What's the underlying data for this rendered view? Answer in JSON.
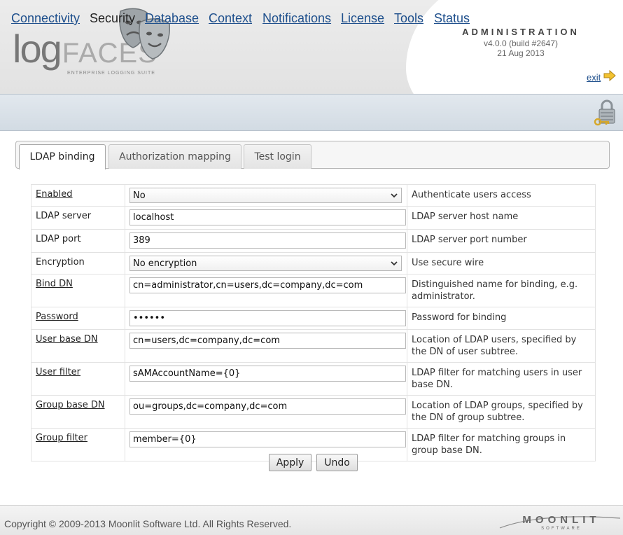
{
  "header": {
    "logo_main": "log",
    "logo_accent": "FACES",
    "logo_tagline": "ENTERPRISE LOGGING SUITE",
    "title": "ADMINISTRATION",
    "version": "v4.0.0 (build #2647)",
    "date": "21 Aug 2013",
    "exit_label": "exit"
  },
  "nav": {
    "items": [
      {
        "label": "Connectivity",
        "active": false
      },
      {
        "label": "Security",
        "active": true
      },
      {
        "label": "Database",
        "active": false
      },
      {
        "label": "Context",
        "active": false
      },
      {
        "label": "Notifications",
        "active": false
      },
      {
        "label": "License",
        "active": false
      },
      {
        "label": "Tools",
        "active": false
      },
      {
        "label": "Status",
        "active": false
      }
    ]
  },
  "tabs": [
    {
      "label": "LDAP binding",
      "active": true
    },
    {
      "label": "Authorization mapping",
      "active": false
    },
    {
      "label": "Test login",
      "active": false
    }
  ],
  "form": {
    "enabled": {
      "label": "Enabled",
      "value": "No",
      "description": "Authenticate users access"
    },
    "ldap_server": {
      "label": "LDAP server",
      "value": "localhost",
      "description": "LDAP server host name"
    },
    "ldap_port": {
      "label": "LDAP port",
      "value": "389",
      "description": "LDAP server port number"
    },
    "encryption": {
      "label": "Encryption",
      "value": "No encryption",
      "description": "Use secure wire"
    },
    "bind_dn": {
      "label": "Bind DN",
      "value": "cn=administrator,cn=users,dc=company,dc=com",
      "description": "Distinguished name for binding, e.g. administrator."
    },
    "password": {
      "label": "Password",
      "value": "••••••",
      "description": "Password for binding"
    },
    "user_base_dn": {
      "label": "User base DN",
      "value": "cn=users,dc=company,dc=com",
      "description": "Location of LDAP users, specified by the DN of user subtree."
    },
    "user_filter": {
      "label": "User filter",
      "value": "sAMAccountName={0}",
      "description": "LDAP filter for matching users in user base DN."
    },
    "group_base_dn": {
      "label": "Group base DN",
      "value": "ou=groups,dc=company,dc=com",
      "description": "Location of LDAP groups, specified by the DN of group subtree."
    },
    "group_filter": {
      "label": "Group filter",
      "value": "member={0}",
      "description": "LDAP filter for matching groups in group base DN."
    }
  },
  "buttons": {
    "apply": "Apply",
    "undo": "Undo"
  },
  "footer": {
    "copyright": "Copyright © 2009-2013 Moonlit Software Ltd. All Rights Reserved.",
    "brand": "MOONLIT",
    "brand_sub": "SOFTWARE"
  },
  "icons": {
    "masks": "theatre-masks-icon",
    "exit": "arrow-right-icon",
    "lock": "padlock-key-icon",
    "select": "chevron-down-icon"
  },
  "colors": {
    "link": "#1e4f8c",
    "nav_bg": "#dbe2e8"
  }
}
